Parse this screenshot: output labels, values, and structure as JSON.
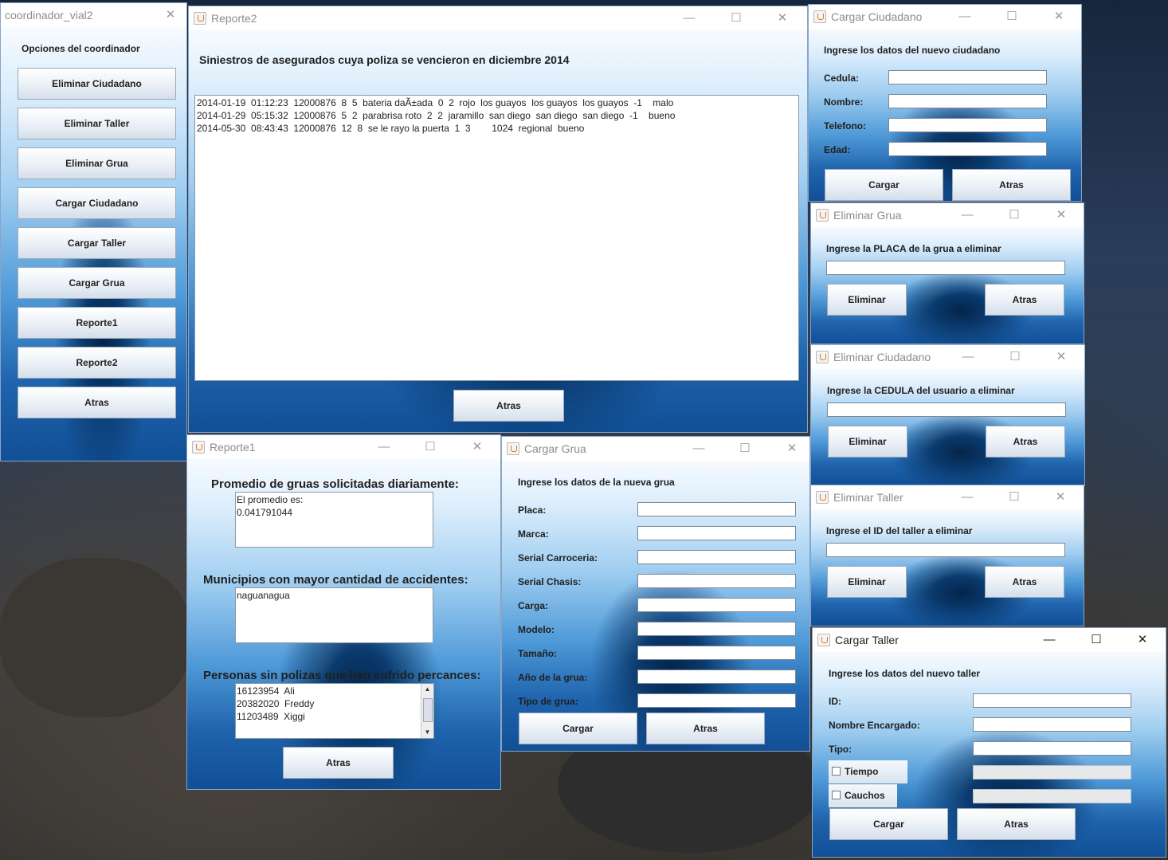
{
  "coordinador": {
    "title": "coordinador_vial2",
    "heading": "Opciones del coordinador",
    "buttons": [
      "Eliminar Ciudadano",
      "Eliminar Taller",
      "Eliminar Grua",
      "Cargar Ciudadano",
      "Cargar Taller",
      "Cargar Grua",
      "Reporte1",
      "Reporte2",
      "Atras"
    ]
  },
  "reporte2": {
    "title": "Reporte2",
    "heading": "Siniestros de asegurados cuya poliza se vencieron en diciembre 2014",
    "rows": [
      "2014-01-19  01:12:23  12000876  8  5  bateria daÃ±ada  0  2  rojo  los guayos  los guayos  los guayos  -1    malo",
      "2014-01-29  05:15:32  12000876  5  2  parabrisa roto  2  2  jaramillo  san diego  san diego  san diego  -1    bueno",
      "2014-05-30  08:43:43  12000876  12  8  se le rayo la puerta  1  3        1024  regional  bueno"
    ],
    "atras": "Atras"
  },
  "reporte1": {
    "title": "Reporte1",
    "label_promedio": "Promedio de gruas solicitadas diariamente:",
    "promedio_lines": [
      "El promedio es:",
      "0.041791044"
    ],
    "label_municipios": "Municipios con mayor cantidad de accidentes:",
    "municipios_lines": [
      "naguanagua"
    ],
    "label_personas": "Personas sin polizas que han sufrido percances:",
    "personas_lines": [
      "16123954  Ali",
      "20382020  Freddy",
      "11203489  Xiggi"
    ],
    "atras": "Atras"
  },
  "cargar_ciudadano": {
    "title": "Cargar Ciudadano",
    "heading": "Ingrese los datos del nuevo ciudadano",
    "fields": [
      "Cedula:",
      "Nombre:",
      "Telefono:",
      "Edad:"
    ],
    "cargar": "Cargar",
    "atras": "Atras"
  },
  "eliminar_grua": {
    "title": "Eliminar Grua",
    "heading": "Ingrese la PLACA de la grua a eliminar",
    "eliminar": "Eliminar",
    "atras": "Atras"
  },
  "eliminar_ciudadano": {
    "title": "Eliminar Ciudadano",
    "heading": "Ingrese la CEDULA del usuario a eliminar",
    "eliminar": "Eliminar",
    "atras": "Atras"
  },
  "eliminar_taller": {
    "title": "Eliminar Taller",
    "heading": "Ingrese el ID del taller a eliminar",
    "eliminar": "Eliminar",
    "atras": "Atras"
  },
  "cargar_grua": {
    "title": "Cargar Grua",
    "heading": "Ingrese los datos de la nueva grua",
    "fields": [
      "Placa:",
      "Marca:",
      "Serial Carroceria:",
      "Serial Chasis:",
      "Carga:",
      "Modelo:",
      "Tamaño:",
      "Año de la grua:",
      "Tipo de grua:"
    ],
    "cargar": "Cargar",
    "atras": "Atras"
  },
  "cargar_taller": {
    "title": "Cargar Taller",
    "heading": "Ingrese los datos del nuevo taller",
    "fields": [
      "ID:",
      "Nombre Encargado:",
      "Tipo:"
    ],
    "checkboxes": [
      "Tiempo",
      "Cauchos"
    ],
    "cargar": "Cargar",
    "atras": "Atras"
  },
  "controls": {
    "minimize": "—",
    "maximize": "☐",
    "close": "✕"
  }
}
